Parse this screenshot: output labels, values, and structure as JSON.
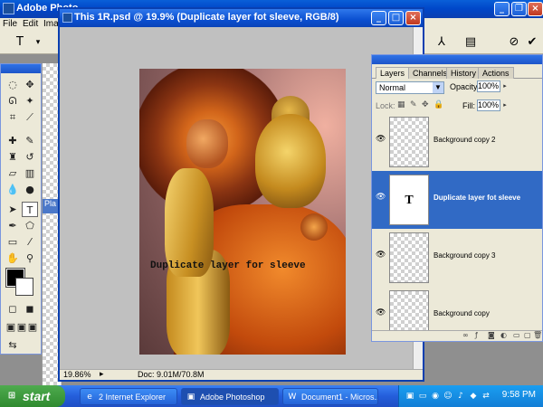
{
  "app": {
    "title": "Adobe Photo",
    "menu": [
      "File",
      "Edit",
      "Image"
    ]
  },
  "document": {
    "title": "This 1R.psd @ 19.9% (Duplicate layer fot sleeve, RGB/8)",
    "zoom": "19.86%",
    "doc_info": "Doc: 9.01M/70.8M",
    "type_text": "Duplicate layer for sleeve"
  },
  "ie_tab_text": "Pla",
  "layers_panel": {
    "tabs": [
      "Layers",
      "Channels",
      "History",
      "Actions"
    ],
    "active_tab": "Layers",
    "blend_mode": "Normal",
    "opacity_label": "Opacity:",
    "opacity_value": "100%",
    "lock_label": "Lock:",
    "fill_label": "Fill:",
    "fill_value": "100%",
    "layers": [
      {
        "name": "Background copy 2",
        "selected": false,
        "thumb": "checker"
      },
      {
        "name": "Duplicate layer fot sleeve",
        "selected": true,
        "thumb": "type",
        "thumb_glyph": "T"
      },
      {
        "name": "Background copy 3",
        "selected": false,
        "thumb": "checker"
      },
      {
        "name": "Background copy",
        "selected": false,
        "thumb": "checker"
      }
    ]
  },
  "taskbar": {
    "start_label": "start",
    "tasks": [
      {
        "label": "2 Internet Explorer",
        "icon": "ie-icon"
      },
      {
        "label": "Adobe Photoshop",
        "icon": "photoshop-icon",
        "active": true
      },
      {
        "label": "Document1 - Micros...",
        "icon": "word-icon"
      }
    ],
    "clock": "9:58 PM"
  }
}
